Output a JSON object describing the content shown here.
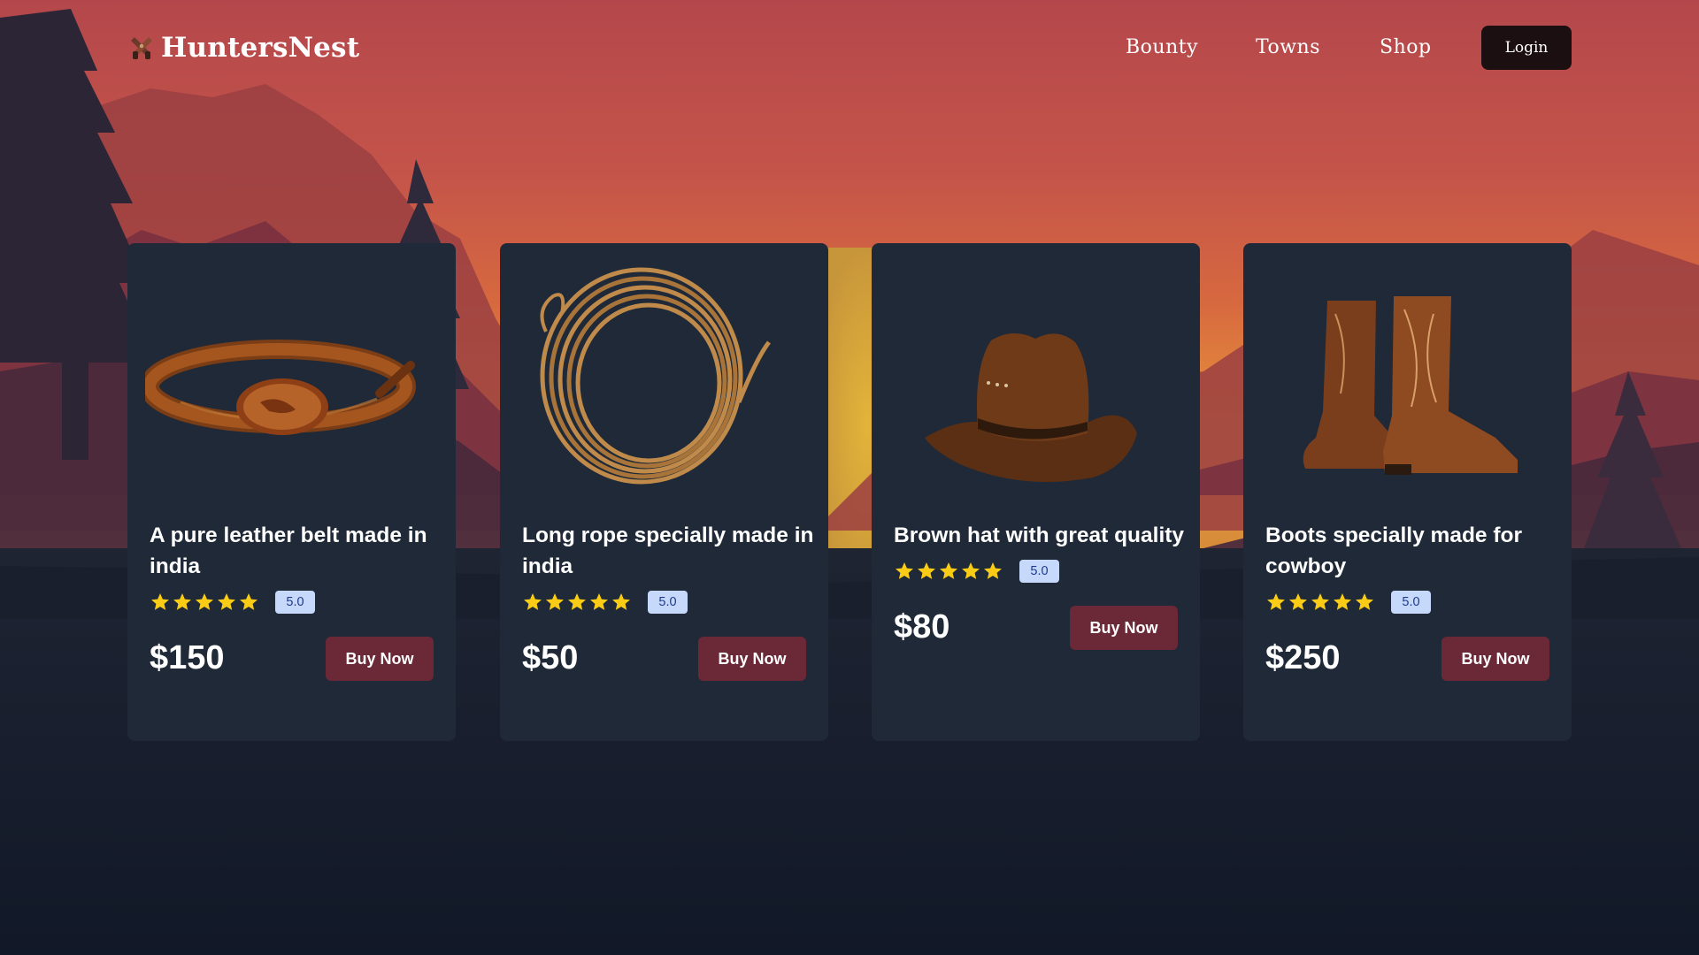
{
  "brand": {
    "name": "HuntersNest"
  },
  "nav": {
    "links": [
      "Bounty",
      "Towns",
      "Shop"
    ],
    "login_label": "Login"
  },
  "products": [
    {
      "title": "A pure leather belt made in india",
      "rating": "5.0",
      "stars": 5,
      "price": "$150",
      "button": "Buy Now",
      "image": "leather-belt"
    },
    {
      "title": "Long rope specially made in india",
      "rating": "5.0",
      "stars": 5,
      "price": "$50",
      "button": "Buy Now",
      "image": "rope-coil"
    },
    {
      "title": "Brown hat with great quality",
      "rating": "5.0",
      "stars": 5,
      "price": "$80",
      "button": "Buy Now",
      "image": "cowboy-hat"
    },
    {
      "title": "Boots specially made for cowboy",
      "rating": "5.0",
      "stars": 5,
      "price": "$250",
      "button": "Buy Now",
      "image": "cowboy-boots"
    }
  ],
  "colors": {
    "sky_top": "#b4474b",
    "sky_glow": "#e07b3c",
    "card_bg": "#1f2937",
    "page_bg": "#111827",
    "buy_button": "#6b2937",
    "login_button": "#1c0f12",
    "star": "#facc15",
    "rating_badge": "#c7d9fb"
  }
}
